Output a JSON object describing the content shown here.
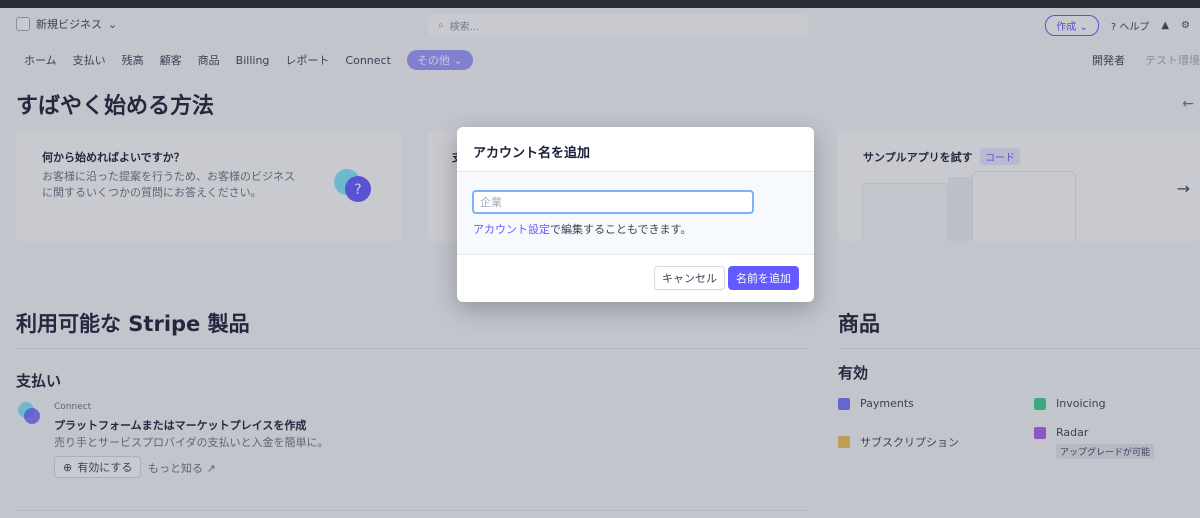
{
  "header": {
    "account_name": "新規ビジネス",
    "search_placeholder": "検索...",
    "create_label": "作成",
    "help_label": "ヘルプ"
  },
  "nav": {
    "items": [
      "ホーム",
      "支払い",
      "残高",
      "顧客",
      "商品",
      "Billing",
      "レポート",
      "Connect"
    ],
    "more_label": "その他",
    "developer_label": "開発者",
    "test_env_label": "テスト環境"
  },
  "quickstart": {
    "title": "すばやく始める方法",
    "card1_title": "何から始めればよいですか？",
    "card1_text": "お客様に沿った提案を行うため、お客様のビジネスに関するいくつかの質問にお答えください。",
    "card2_title_partial": "支",
    "card3_title": "サンプルアプリを試す",
    "card3_badge": "コード"
  },
  "products": {
    "title": "利用可能な Stripe 製品",
    "section": "支払い",
    "connect_label": "Connect",
    "connect_title": "プラットフォームまたはマーケットプレイスを作成",
    "connect_desc": "売り手とサービスプロバイダの支払いと入金を簡単に。",
    "enable_label": "有効にする",
    "learn_more": "もっと知る"
  },
  "right_panel": {
    "title": "商品",
    "active_label": "有効",
    "items": [
      {
        "label": "Payments",
        "color": "#7a73ff"
      },
      {
        "label": "Invoicing",
        "color": "#3ecf8e"
      },
      {
        "label": "サブスクリプション",
        "color": "#f5be58"
      },
      {
        "label": "Radar",
        "color": "#a960ee"
      }
    ],
    "radar_tag": "アップグレードが可能"
  },
  "modal": {
    "title": "アカウント名を追加",
    "input_placeholder": "企業",
    "input_value": "",
    "hint_link": "アカウント設定",
    "hint_text": "で編集することもできます。",
    "cancel_label": "キャンセル",
    "submit_label": "名前を追加"
  },
  "colors": {
    "accent": "#635bff",
    "input_focus": "#7fb0ff"
  }
}
